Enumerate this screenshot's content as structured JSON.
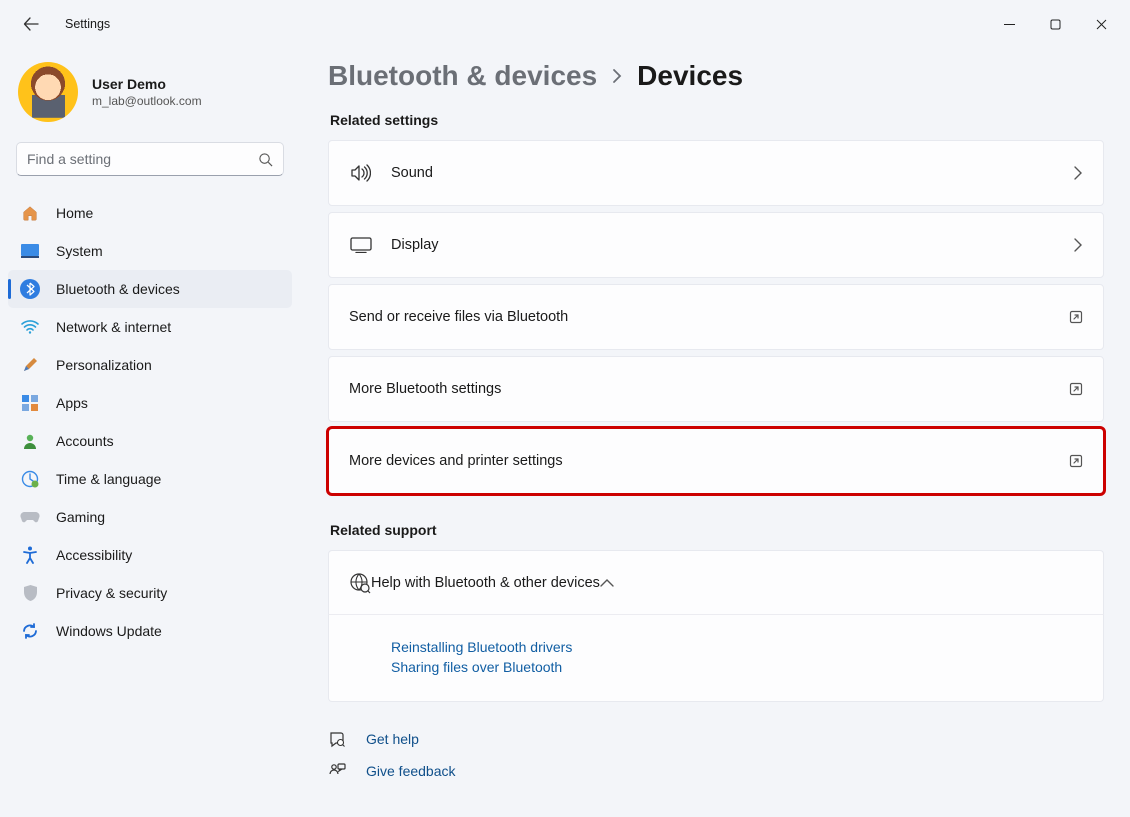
{
  "window": {
    "title": "Settings"
  },
  "user": {
    "name": "User Demo",
    "email": "m_lab@outlook.com"
  },
  "search": {
    "placeholder": "Find a setting"
  },
  "sidebar": {
    "items": [
      {
        "label": "Home"
      },
      {
        "label": "System"
      },
      {
        "label": "Bluetooth & devices"
      },
      {
        "label": "Network & internet"
      },
      {
        "label": "Personalization"
      },
      {
        "label": "Apps"
      },
      {
        "label": "Accounts"
      },
      {
        "label": "Time & language"
      },
      {
        "label": "Gaming"
      },
      {
        "label": "Accessibility"
      },
      {
        "label": "Privacy & security"
      },
      {
        "label": "Windows Update"
      }
    ]
  },
  "breadcrumb": {
    "parent": "Bluetooth & devices",
    "current": "Devices"
  },
  "sections": {
    "related_settings": {
      "heading": "Related settings",
      "items": [
        {
          "label": "Sound"
        },
        {
          "label": "Display"
        },
        {
          "label": "Send or receive files via Bluetooth"
        },
        {
          "label": "More Bluetooth settings"
        },
        {
          "label": "More devices and printer settings"
        }
      ]
    },
    "related_support": {
      "heading": "Related support",
      "expander": "Help with Bluetooth & other devices",
      "links": [
        "Reinstalling Bluetooth drivers",
        "Sharing files over Bluetooth"
      ]
    }
  },
  "footer": {
    "get_help": "Get help",
    "feedback": "Give feedback"
  }
}
